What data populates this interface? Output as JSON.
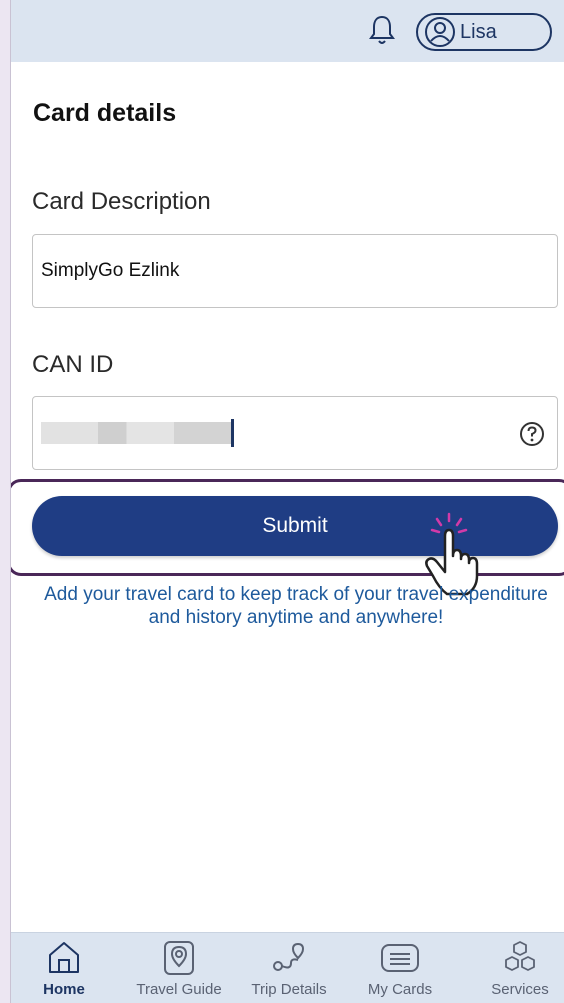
{
  "header": {
    "user_name": "Lisa"
  },
  "form": {
    "title": "Card details",
    "description_label": "Card Description",
    "description_value": "SimplyGo Ezlink",
    "can_label": "CAN ID",
    "submit_label": "Submit",
    "info_text": "Add your travel card to keep track of your travel expenditure and history anytime and anywhere!"
  },
  "nav": {
    "items": [
      {
        "label": "Home",
        "icon": "home-icon",
        "active": true
      },
      {
        "label": "Travel Guide",
        "icon": "map-pin-icon",
        "active": false
      },
      {
        "label": "Trip Details",
        "icon": "route-icon",
        "active": false
      },
      {
        "label": "My Cards",
        "icon": "card-icon",
        "active": false
      },
      {
        "label": "Services",
        "icon": "boxes-icon",
        "active": false
      }
    ]
  },
  "colors": {
    "primary": "#1f3d84",
    "header_bg": "#dbe4f0",
    "info_text": "#1e5a9c",
    "highlight_frame": "#4a2758"
  }
}
